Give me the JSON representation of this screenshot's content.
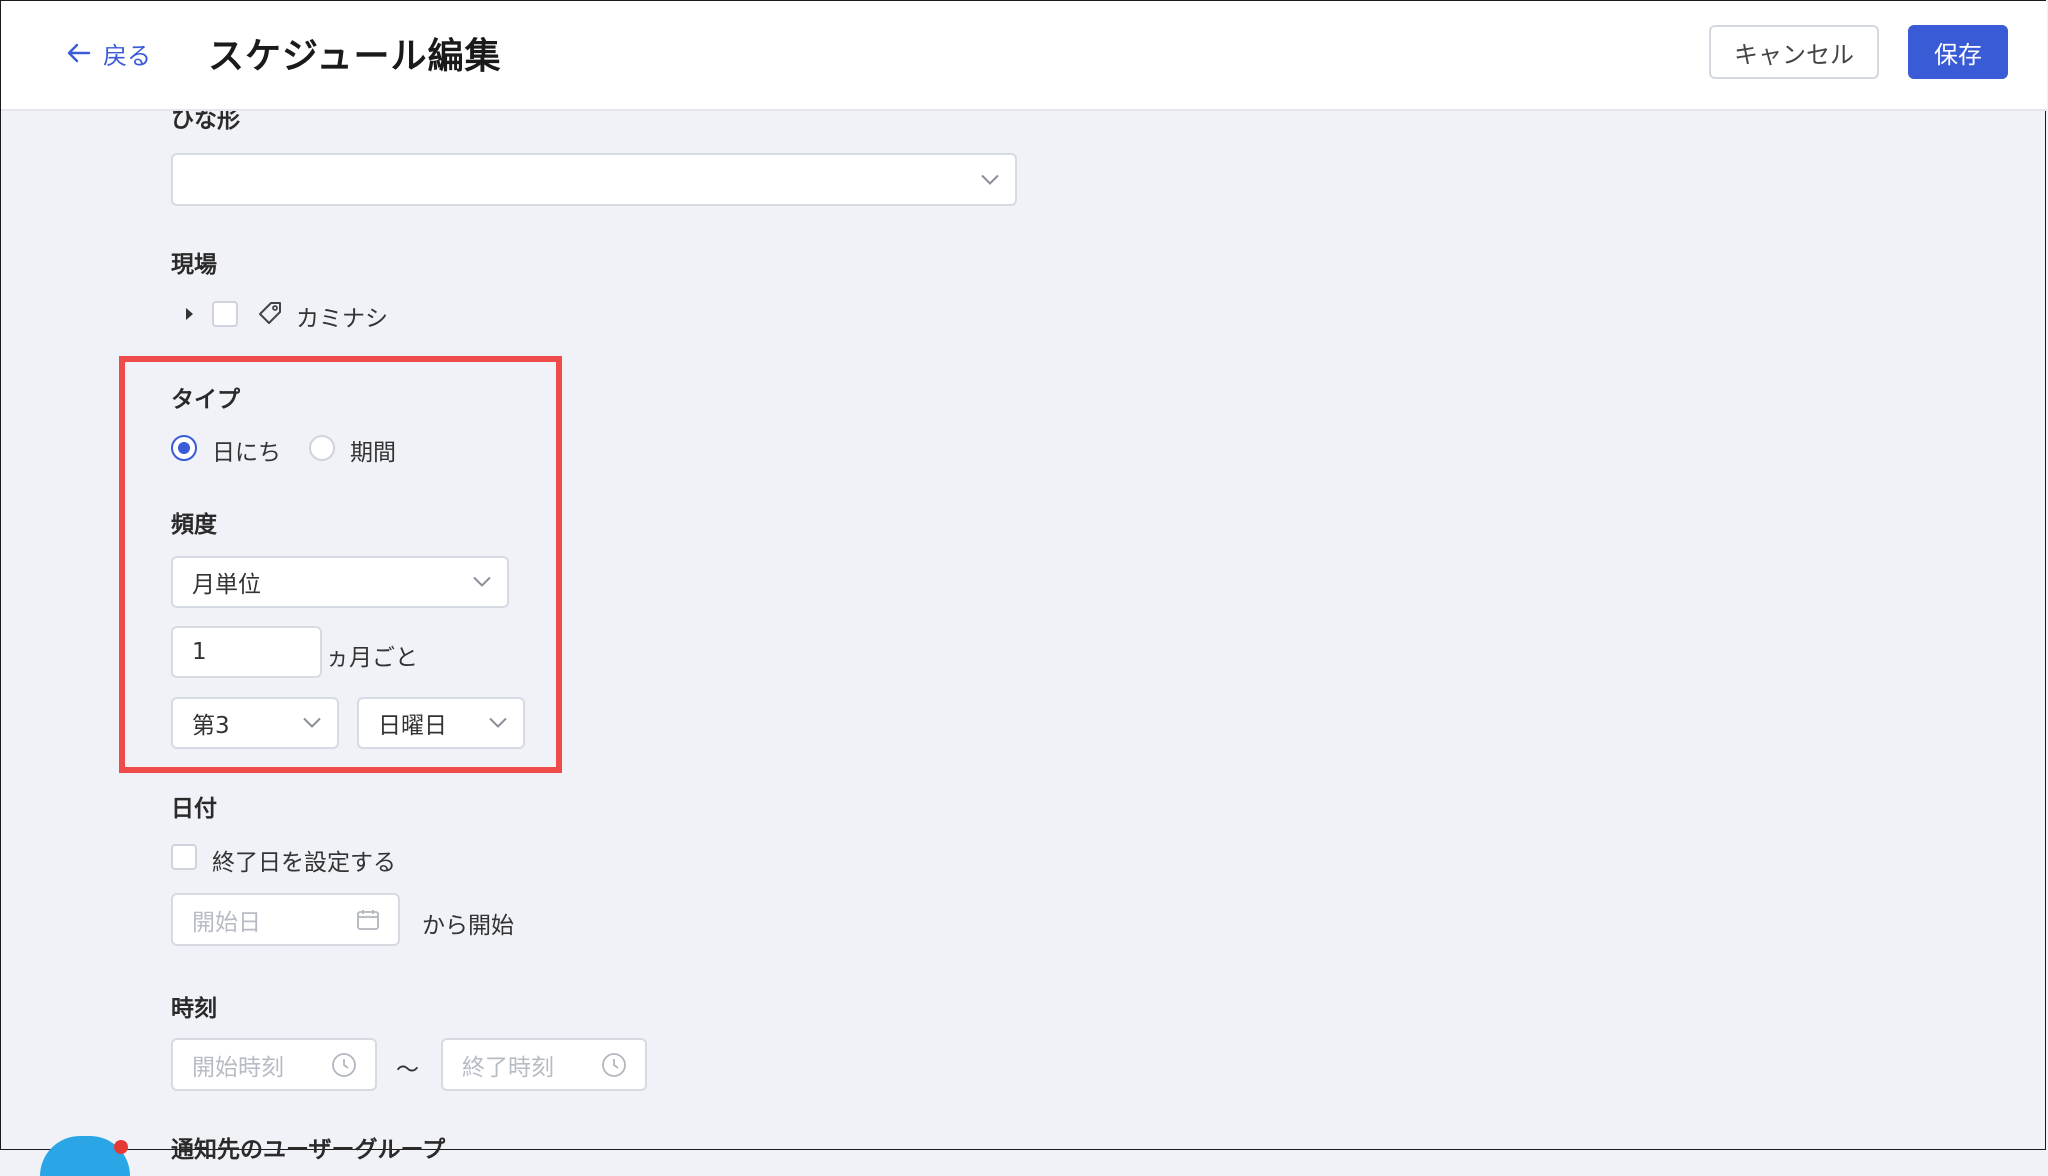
{
  "header": {
    "back_label": "戻る",
    "title": "スケジュール編集",
    "cancel_label": "キャンセル",
    "save_label": "保存"
  },
  "template_section": {
    "label": "ひな形",
    "value": ""
  },
  "site_section": {
    "label": "現場",
    "tree_item_label": "カミナシ"
  },
  "type_section": {
    "label": "タイプ",
    "options": [
      {
        "label": "日にち",
        "selected": true
      },
      {
        "label": "期間",
        "selected": false
      }
    ]
  },
  "frequency_section": {
    "label": "頻度",
    "unit_value": "月単位",
    "interval_value": "1",
    "interval_suffix": "ヵ月ごと",
    "week_value": "第3",
    "weekday_value": "日曜日"
  },
  "date_section": {
    "label": "日付",
    "end_date_checkbox_label": "終了日を設定する",
    "start_date_placeholder": "開始日",
    "start_suffix": "から開始"
  },
  "time_section": {
    "label": "時刻",
    "start_time_placeholder": "開始時刻",
    "separator": "〜",
    "end_time_placeholder": "終了時刻"
  },
  "notify_section": {
    "label": "通知先のユーザーグループ"
  },
  "colors": {
    "accent": "#3a5bd6",
    "highlight": "#ef4b4b",
    "background": "#f0f2f7"
  }
}
